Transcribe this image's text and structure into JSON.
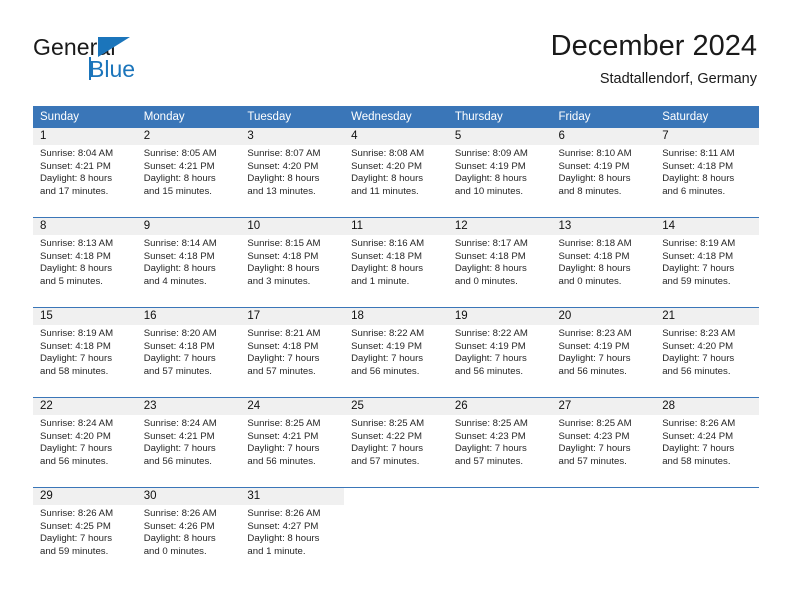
{
  "brand": {
    "name_top": "General",
    "name_bottom": "Blue",
    "accent_color": "#1b75bb",
    "flag_icon": "brand-flag-icon"
  },
  "header": {
    "title": "December 2024",
    "subtitle": "Stadtallendorf, Germany"
  },
  "theme": {
    "header_row_bg": "#3a76b8",
    "daynum_bg": "#f0f0f0",
    "page_bg": "#ffffff",
    "text_color": "#262626"
  },
  "weekdays": [
    "Sunday",
    "Monday",
    "Tuesday",
    "Wednesday",
    "Thursday",
    "Friday",
    "Saturday"
  ],
  "weeks": [
    [
      {
        "day": "1",
        "sunrise": "Sunrise: 8:04 AM",
        "sunset": "Sunset: 4:21 PM",
        "daylight1": "Daylight: 8 hours",
        "daylight2": "and 17 minutes."
      },
      {
        "day": "2",
        "sunrise": "Sunrise: 8:05 AM",
        "sunset": "Sunset: 4:21 PM",
        "daylight1": "Daylight: 8 hours",
        "daylight2": "and 15 minutes."
      },
      {
        "day": "3",
        "sunrise": "Sunrise: 8:07 AM",
        "sunset": "Sunset: 4:20 PM",
        "daylight1": "Daylight: 8 hours",
        "daylight2": "and 13 minutes."
      },
      {
        "day": "4",
        "sunrise": "Sunrise: 8:08 AM",
        "sunset": "Sunset: 4:20 PM",
        "daylight1": "Daylight: 8 hours",
        "daylight2": "and 11 minutes."
      },
      {
        "day": "5",
        "sunrise": "Sunrise: 8:09 AM",
        "sunset": "Sunset: 4:19 PM",
        "daylight1": "Daylight: 8 hours",
        "daylight2": "and 10 minutes."
      },
      {
        "day": "6",
        "sunrise": "Sunrise: 8:10 AM",
        "sunset": "Sunset: 4:19 PM",
        "daylight1": "Daylight: 8 hours",
        "daylight2": "and 8 minutes."
      },
      {
        "day": "7",
        "sunrise": "Sunrise: 8:11 AM",
        "sunset": "Sunset: 4:18 PM",
        "daylight1": "Daylight: 8 hours",
        "daylight2": "and 6 minutes."
      }
    ],
    [
      {
        "day": "8",
        "sunrise": "Sunrise: 8:13 AM",
        "sunset": "Sunset: 4:18 PM",
        "daylight1": "Daylight: 8 hours",
        "daylight2": "and 5 minutes."
      },
      {
        "day": "9",
        "sunrise": "Sunrise: 8:14 AM",
        "sunset": "Sunset: 4:18 PM",
        "daylight1": "Daylight: 8 hours",
        "daylight2": "and 4 minutes."
      },
      {
        "day": "10",
        "sunrise": "Sunrise: 8:15 AM",
        "sunset": "Sunset: 4:18 PM",
        "daylight1": "Daylight: 8 hours",
        "daylight2": "and 3 minutes."
      },
      {
        "day": "11",
        "sunrise": "Sunrise: 8:16 AM",
        "sunset": "Sunset: 4:18 PM",
        "daylight1": "Daylight: 8 hours",
        "daylight2": "and 1 minute."
      },
      {
        "day": "12",
        "sunrise": "Sunrise: 8:17 AM",
        "sunset": "Sunset: 4:18 PM",
        "daylight1": "Daylight: 8 hours",
        "daylight2": "and 0 minutes."
      },
      {
        "day": "13",
        "sunrise": "Sunrise: 8:18 AM",
        "sunset": "Sunset: 4:18 PM",
        "daylight1": "Daylight: 8 hours",
        "daylight2": "and 0 minutes."
      },
      {
        "day": "14",
        "sunrise": "Sunrise: 8:19 AM",
        "sunset": "Sunset: 4:18 PM",
        "daylight1": "Daylight: 7 hours",
        "daylight2": "and 59 minutes."
      }
    ],
    [
      {
        "day": "15",
        "sunrise": "Sunrise: 8:19 AM",
        "sunset": "Sunset: 4:18 PM",
        "daylight1": "Daylight: 7 hours",
        "daylight2": "and 58 minutes."
      },
      {
        "day": "16",
        "sunrise": "Sunrise: 8:20 AM",
        "sunset": "Sunset: 4:18 PM",
        "daylight1": "Daylight: 7 hours",
        "daylight2": "and 57 minutes."
      },
      {
        "day": "17",
        "sunrise": "Sunrise: 8:21 AM",
        "sunset": "Sunset: 4:18 PM",
        "daylight1": "Daylight: 7 hours",
        "daylight2": "and 57 minutes."
      },
      {
        "day": "18",
        "sunrise": "Sunrise: 8:22 AM",
        "sunset": "Sunset: 4:19 PM",
        "daylight1": "Daylight: 7 hours",
        "daylight2": "and 56 minutes."
      },
      {
        "day": "19",
        "sunrise": "Sunrise: 8:22 AM",
        "sunset": "Sunset: 4:19 PM",
        "daylight1": "Daylight: 7 hours",
        "daylight2": "and 56 minutes."
      },
      {
        "day": "20",
        "sunrise": "Sunrise: 8:23 AM",
        "sunset": "Sunset: 4:19 PM",
        "daylight1": "Daylight: 7 hours",
        "daylight2": "and 56 minutes."
      },
      {
        "day": "21",
        "sunrise": "Sunrise: 8:23 AM",
        "sunset": "Sunset: 4:20 PM",
        "daylight1": "Daylight: 7 hours",
        "daylight2": "and 56 minutes."
      }
    ],
    [
      {
        "day": "22",
        "sunrise": "Sunrise: 8:24 AM",
        "sunset": "Sunset: 4:20 PM",
        "daylight1": "Daylight: 7 hours",
        "daylight2": "and 56 minutes."
      },
      {
        "day": "23",
        "sunrise": "Sunrise: 8:24 AM",
        "sunset": "Sunset: 4:21 PM",
        "daylight1": "Daylight: 7 hours",
        "daylight2": "and 56 minutes."
      },
      {
        "day": "24",
        "sunrise": "Sunrise: 8:25 AM",
        "sunset": "Sunset: 4:21 PM",
        "daylight1": "Daylight: 7 hours",
        "daylight2": "and 56 minutes."
      },
      {
        "day": "25",
        "sunrise": "Sunrise: 8:25 AM",
        "sunset": "Sunset: 4:22 PM",
        "daylight1": "Daylight: 7 hours",
        "daylight2": "and 57 minutes."
      },
      {
        "day": "26",
        "sunrise": "Sunrise: 8:25 AM",
        "sunset": "Sunset: 4:23 PM",
        "daylight1": "Daylight: 7 hours",
        "daylight2": "and 57 minutes."
      },
      {
        "day": "27",
        "sunrise": "Sunrise: 8:25 AM",
        "sunset": "Sunset: 4:23 PM",
        "daylight1": "Daylight: 7 hours",
        "daylight2": "and 57 minutes."
      },
      {
        "day": "28",
        "sunrise": "Sunrise: 8:26 AM",
        "sunset": "Sunset: 4:24 PM",
        "daylight1": "Daylight: 7 hours",
        "daylight2": "and 58 minutes."
      }
    ],
    [
      {
        "day": "29",
        "sunrise": "Sunrise: 8:26 AM",
        "sunset": "Sunset: 4:25 PM",
        "daylight1": "Daylight: 7 hours",
        "daylight2": "and 59 minutes."
      },
      {
        "day": "30",
        "sunrise": "Sunrise: 8:26 AM",
        "sunset": "Sunset: 4:26 PM",
        "daylight1": "Daylight: 8 hours",
        "daylight2": "and 0 minutes."
      },
      {
        "day": "31",
        "sunrise": "Sunrise: 8:26 AM",
        "sunset": "Sunset: 4:27 PM",
        "daylight1": "Daylight: 8 hours",
        "daylight2": "and 1 minute."
      },
      {
        "day": "",
        "sunrise": "",
        "sunset": "",
        "daylight1": "",
        "daylight2": ""
      },
      {
        "day": "",
        "sunrise": "",
        "sunset": "",
        "daylight1": "",
        "daylight2": ""
      },
      {
        "day": "",
        "sunrise": "",
        "sunset": "",
        "daylight1": "",
        "daylight2": ""
      },
      {
        "day": "",
        "sunrise": "",
        "sunset": "",
        "daylight1": "",
        "daylight2": ""
      }
    ]
  ]
}
